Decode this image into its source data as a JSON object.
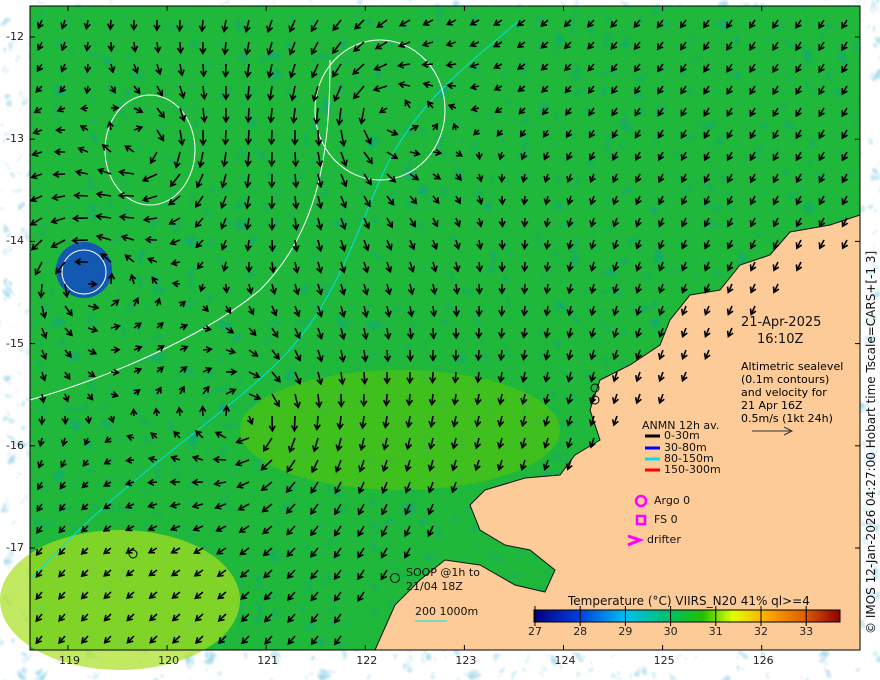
{
  "map": {
    "lon_ticks": [
      "119",
      "120",
      "121",
      "122",
      "123",
      "124",
      "125",
      "126"
    ],
    "lat_ticks": [
      "-12",
      "-13",
      "-14",
      "-15",
      "-16",
      "-17"
    ],
    "date": "21-Apr-2025",
    "time": "16:10Z",
    "altimetry_note": [
      "Altimetric sealevel",
      "(0.1m contours)",
      "and velocity for",
      "21 Apr 16Z",
      "0.5m/s (1kt 24h)"
    ],
    "anmn": {
      "title": "ANMN 12h av.",
      "items": [
        {
          "label": "0-30m",
          "color": "#000000"
        },
        {
          "label": "30-80m",
          "color": "#0000ff"
        },
        {
          "label": "80-150m",
          "color": "#00e0e0"
        },
        {
          "label": "150-300m",
          "color": "#ff0000"
        }
      ]
    },
    "argo": "Argo 0",
    "fs": "FS 0",
    "drifter": "drifter",
    "soop": [
      "SOOP @1h to",
      "21/04 18Z"
    ],
    "isobath_label": "200  1000m",
    "colorbar": {
      "title": "Temperature (°C) VIIRS_N20 41% ql>=4",
      "ticks": [
        "27",
        "28",
        "29",
        "30",
        "31",
        "32",
        "33"
      ],
      "range": [
        27,
        33.8
      ]
    },
    "credit": "© IMOS 12-Jan-2026 04:27:00 Hobart time Tscale=CARS+[-1 3]",
    "colors": {
      "land": "#fccb98",
      "sea": "#1fb83a",
      "marker": "#ff00ff",
      "isobath": "#00e0e0"
    }
  }
}
